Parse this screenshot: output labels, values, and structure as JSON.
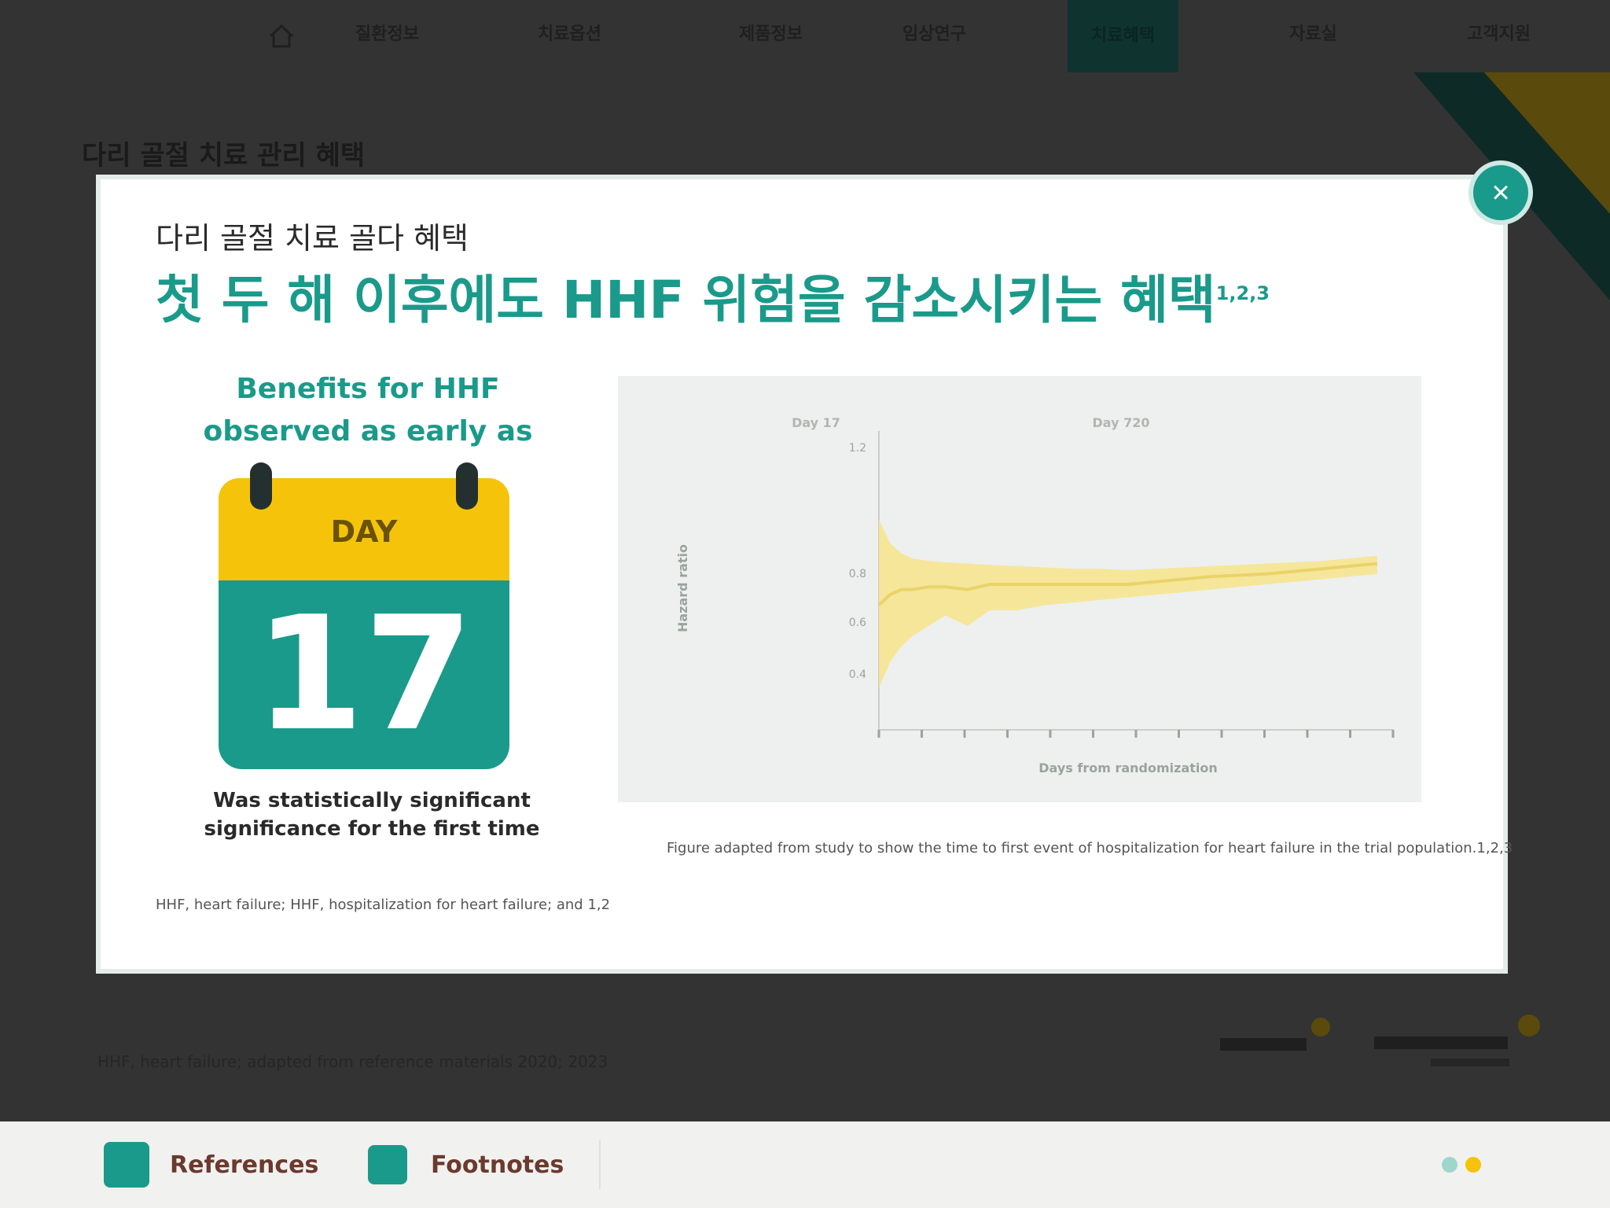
{
  "nav": {
    "items": [
      {
        "label": "질환정보"
      },
      {
        "label": "치료옵션"
      },
      {
        "label": "제품정보"
      },
      {
        "label": "임상연구"
      },
      {
        "label": "치료혜택"
      },
      {
        "label": "자료실"
      },
      {
        "label": "고객지원"
      }
    ],
    "active_index": 4
  },
  "section_title": "다리 골절 치료 관리 혜택",
  "modal": {
    "close_label": "×",
    "eyebrow": "다리 골절 치료 골다 혜택",
    "headline": "첫 두 해 이후에도 HHF 위험을 감소시키는 혜택",
    "headline_ref": "1,2,3",
    "calendar": {
      "heading_lines": [
        "Benefits for HHF",
        "observed as early as"
      ],
      "month": "DAY",
      "day": "17",
      "caption_lines": [
        "Was statistically significant",
        "significance for the first time"
      ]
    },
    "left_footnote": "HHF, heart failure; HHF, hospitalization for heart failure; and 1,2",
    "chart_footnote": "Figure adapted from study to show the time to first event of hospitalization for heart failure in the trial population.1,2,3"
  },
  "chart_data": {
    "type": "area",
    "x_tick_count": 13,
    "y_ticks": [
      "1.2",
      "0.8",
      "0.6",
      "0.4"
    ],
    "xlabel": "Days from randomization",
    "ylabel": "Hazard ratio",
    "annotations": [
      "Day 17",
      "Day 720"
    ],
    "series": [
      {
        "x": [
          0,
          20,
          40,
          60,
          90,
          120,
          160,
          200,
          250,
          300,
          350,
          400,
          450,
          500,
          550,
          600,
          650,
          700,
          750,
          800,
          850,
          900
        ],
        "upper": [
          1.05,
          0.96,
          0.92,
          0.9,
          0.89,
          0.885,
          0.88,
          0.875,
          0.87,
          0.865,
          0.86,
          0.86,
          0.855,
          0.86,
          0.865,
          0.87,
          0.875,
          0.88,
          0.885,
          0.89,
          0.9,
          0.91
        ],
        "lower": [
          0.4,
          0.5,
          0.56,
          0.6,
          0.64,
          0.68,
          0.64,
          0.7,
          0.7,
          0.72,
          0.73,
          0.74,
          0.75,
          0.76,
          0.77,
          0.78,
          0.79,
          0.8,
          0.81,
          0.82,
          0.83,
          0.84
        ],
        "mid": [
          0.72,
          0.76,
          0.78,
          0.78,
          0.79,
          0.79,
          0.78,
          0.8,
          0.8,
          0.8,
          0.8,
          0.8,
          0.8,
          0.81,
          0.82,
          0.83,
          0.835,
          0.84,
          0.85,
          0.86,
          0.87,
          0.88
        ]
      }
    ],
    "xlim": [
      0,
      900
    ],
    "ylim": [
      0.3,
      1.3
    ],
    "colors": {
      "band": "#f7e48a",
      "line": "#e9d36a"
    }
  },
  "page_footnote": "HHF, heart failure; adapted from reference materials 2020; 2023",
  "bottom_bar": {
    "references_label": "References",
    "footnotes_label": "Footnotes"
  },
  "colors": {
    "accent": "#1a9a8a",
    "yellow": "#f5c40a",
    "background": "#333333"
  }
}
